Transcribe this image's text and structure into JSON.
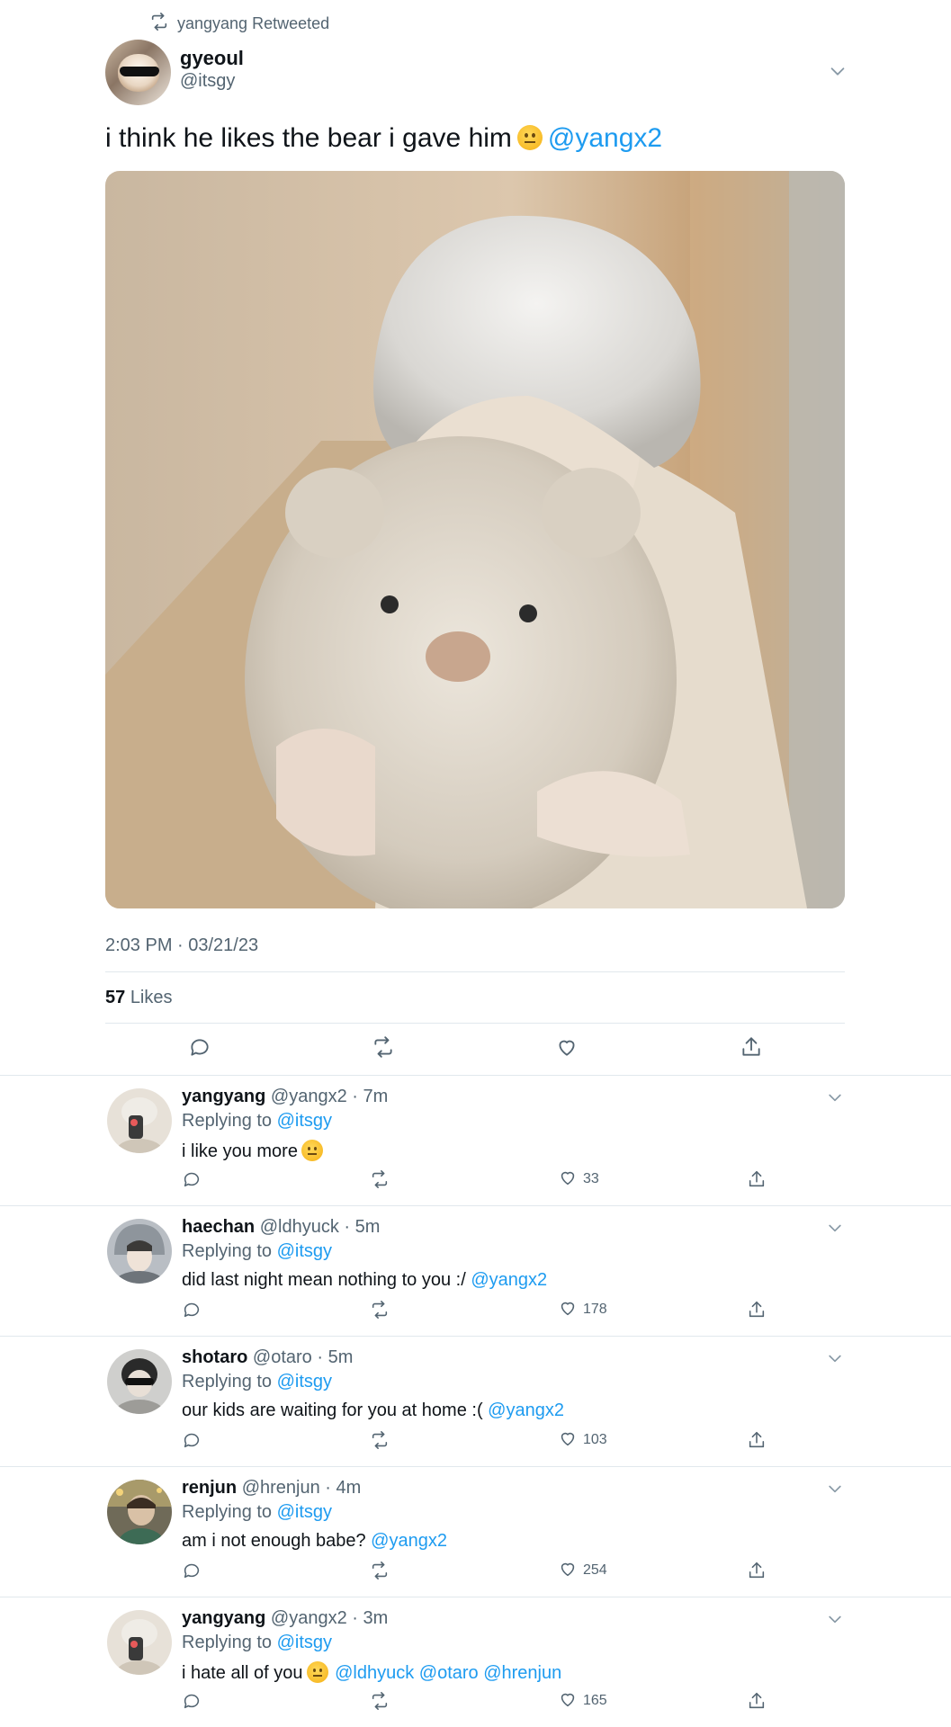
{
  "retweet_banner": {
    "text": "yangyang Retweeted"
  },
  "tweet": {
    "author_name": "gyeoul",
    "author_handle": "@itsgy",
    "text": "i think he likes the bear i gave him",
    "mention": "@yangx2",
    "timestamp": "2:03 PM · 03/21/23",
    "likes_count": "57",
    "likes_label": "Likes"
  },
  "replies": [
    {
      "name": "yangyang",
      "meta": "@yangx2 · 7m",
      "replying_prefix": "Replying to",
      "replying_handle": "@itsgy",
      "text": "i like you more",
      "emoji": "raised-eyebrow-emoji",
      "mentions": "",
      "like_count": "33"
    },
    {
      "name": "haechan",
      "meta": "@ldhyuck · 5m",
      "replying_prefix": "Replying to",
      "replying_handle": "@itsgy",
      "text": "did last night mean nothing to you :/",
      "emoji": "",
      "mentions": "@yangx2",
      "like_count": "178"
    },
    {
      "name": "shotaro",
      "meta": "@otaro · 5m",
      "replying_prefix": "Replying to",
      "replying_handle": "@itsgy",
      "text": "our kids are waiting for you at home :(",
      "emoji": "",
      "mentions": "@yangx2",
      "like_count": "103"
    },
    {
      "name": "renjun",
      "meta": "@hrenjun · 4m",
      "replying_prefix": "Replying to",
      "replying_handle": "@itsgy",
      "text": "am i not enough babe?",
      "emoji": "",
      "mentions": "@yangx2",
      "like_count": "254"
    },
    {
      "name": "yangyang",
      "meta": "@yangx2 · 3m",
      "replying_prefix": "Replying to",
      "replying_handle": "@itsgy",
      "text": "i hate all of you",
      "emoji": "neutral-face-emoji",
      "mentions": "@ldhyuck @otaro @hrenjun",
      "like_count": "165"
    }
  ],
  "icons": {
    "retweet": "retweet-icon",
    "reply": "reply-icon",
    "like": "heart-icon",
    "share": "share-icon",
    "more": "chevron-down-icon"
  },
  "colors": {
    "link": "#1d9bf0",
    "secondary_text": "#536471",
    "primary_text": "#0f1419",
    "divider": "#e1e8ed"
  }
}
